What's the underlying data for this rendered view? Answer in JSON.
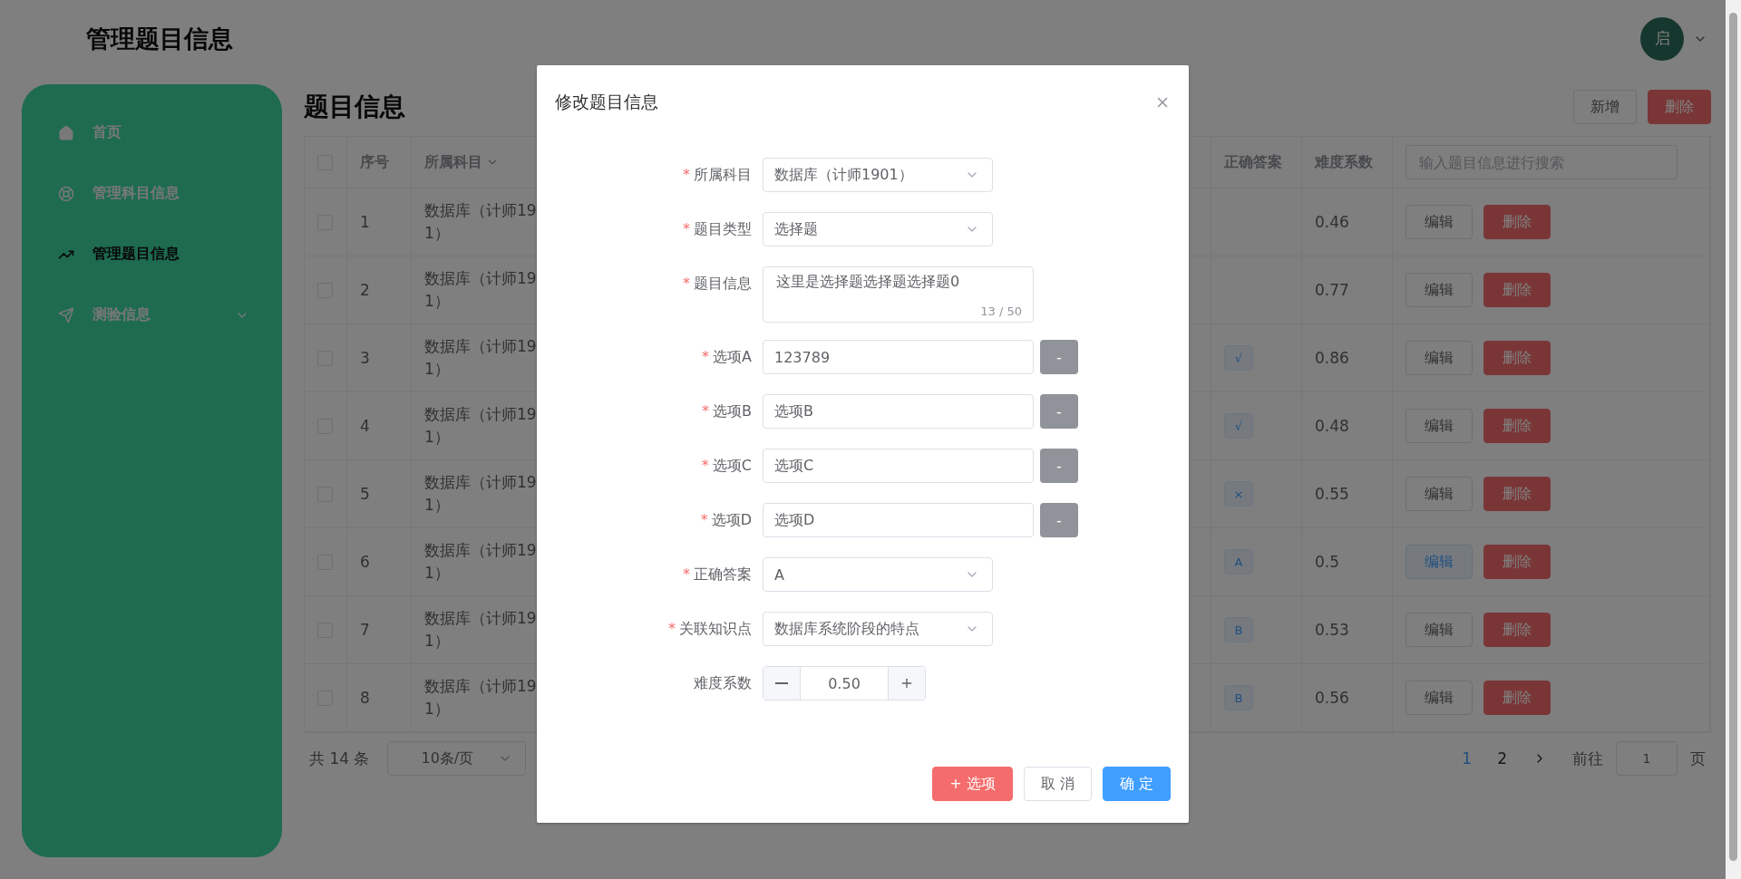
{
  "header": {
    "title": "管理题目信息",
    "avatar": "启"
  },
  "sidebar": {
    "items": [
      {
        "label": "首页",
        "selected": false,
        "has_submenu": false
      },
      {
        "label": "管理科目信息",
        "selected": false,
        "has_submenu": false
      },
      {
        "label": "管理题目信息",
        "selected": true,
        "has_submenu": false
      },
      {
        "label": "测验信息",
        "selected": false,
        "has_submenu": true
      }
    ]
  },
  "main": {
    "title": "题目信息",
    "buttons": [
      {
        "label": "新增",
        "kind": "default"
      },
      {
        "label": "删除",
        "kind": "danger"
      }
    ]
  },
  "table": {
    "header_checked": false,
    "columns": [
      {
        "label": "序号",
        "sortable": false
      },
      {
        "label": "所属科目",
        "sortable": true
      },
      {
        "label": "正确答案",
        "sortable": false
      },
      {
        "label": "难度系数",
        "sortable": false
      }
    ],
    "search": {
      "placeholder": "输入题目信息进行搜索"
    },
    "rows": [
      {
        "checked": false,
        "number": "1",
        "subject_lines": [
          "数据库（计师19",
          "1）"
        ],
        "difficulty": "0.46",
        "edit": "编辑",
        "delete": "删除",
        "hovered": false
      },
      {
        "checked": false,
        "number": "2",
        "subject_lines": [
          "数据库（计师19",
          "1）"
        ],
        "difficulty": "0.77",
        "edit": "编辑",
        "delete": "删除",
        "hovered": false
      },
      {
        "checked": false,
        "number": "3",
        "subject_lines": [
          "数据库（计师19",
          "1）"
        ],
        "answer": "√",
        "difficulty": "0.86",
        "edit": "编辑",
        "delete": "删除",
        "hovered": false
      },
      {
        "checked": false,
        "number": "4",
        "subject_lines": [
          "数据库（计师19",
          "1）"
        ],
        "answer": "√",
        "difficulty": "0.48",
        "edit": "编辑",
        "delete": "删除",
        "hovered": false
      },
      {
        "checked": false,
        "number": "5",
        "subject_lines": [
          "数据库（计师19",
          "1）"
        ],
        "answer": "×",
        "difficulty": "0.55",
        "edit": "编辑",
        "delete": "删除",
        "hovered": false
      },
      {
        "checked": false,
        "number": "6",
        "subject_lines": [
          "数据库（计师19",
          "1）"
        ],
        "answer": "A",
        "difficulty": "0.5",
        "edit": "编辑",
        "delete": "删除",
        "hovered": true
      },
      {
        "checked": false,
        "number": "7",
        "subject_lines": [
          "数据库（计师19",
          "1）"
        ],
        "answer": "B",
        "difficulty": "0.53",
        "edit": "编辑",
        "delete": "删除",
        "hovered": false
      },
      {
        "checked": false,
        "number": "8",
        "subject_lines": [
          "数据库（计师19",
          "1）"
        ],
        "answer": "B",
        "difficulty": "0.56",
        "edit": "编辑",
        "delete": "删除",
        "hovered": false
      }
    ]
  },
  "pagination": {
    "total": "共 14 条",
    "page_size": "10条/页",
    "pages": [
      {
        "label": "1",
        "selected": true
      },
      {
        "label": "2",
        "selected": false
      }
    ],
    "goto_label": "前往",
    "goto_value": "1",
    "goto_suffix": "页"
  },
  "dialog": {
    "title": "修改题目信息",
    "fields": [
      {
        "kind": "select",
        "mark": "*",
        "label": "所属科目",
        "value": "数据库（计师1901）"
      },
      {
        "kind": "select",
        "mark": "*",
        "label": "题目类型",
        "value": "选择题"
      },
      {
        "kind": "textarea",
        "mark": "*",
        "label": "题目信息",
        "value": "这里是选择题选择题选择题0",
        "counter": "13 / 50"
      },
      {
        "kind": "option",
        "mark": "*",
        "label": "选项A",
        "value": "123789",
        "remove": "-"
      },
      {
        "kind": "option",
        "mark": "*",
        "label": "选项B",
        "value": "选项B",
        "remove": "-"
      },
      {
        "kind": "option",
        "mark": "*",
        "label": "选项C",
        "value": "选项C",
        "remove": "-"
      },
      {
        "kind": "option",
        "mark": "*",
        "label": "选项D",
        "value": "选项D",
        "remove": "-"
      },
      {
        "kind": "select",
        "mark": "*",
        "label": "正确答案",
        "value": "A"
      },
      {
        "kind": "select",
        "mark": "*",
        "label": "关联知识点",
        "value": "数据库系统阶段的特点"
      },
      {
        "kind": "number",
        "label": "难度系数",
        "value": "0.50"
      }
    ],
    "buttons": [
      {
        "label": "+ 选项",
        "kind": "danger"
      },
      {
        "label": "取 消",
        "kind": "default"
      },
      {
        "label": "确 定",
        "kind": "primary"
      }
    ]
  }
}
